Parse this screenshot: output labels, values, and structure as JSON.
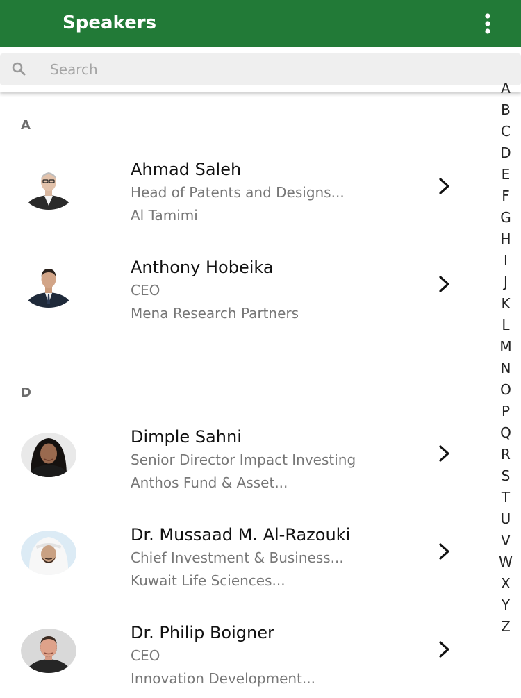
{
  "appbar": {
    "title": "Speakers",
    "menu_icon": "more-vertical-icon",
    "color": "#227a37"
  },
  "search": {
    "placeholder": "Search",
    "value": "",
    "icon": "search-icon"
  },
  "sections": [
    {
      "letter": "A",
      "speakers": [
        {
          "name": "Ahmad Saleh",
          "title": "Head of Patents and Designs...",
          "org": "Al Tamimi"
        },
        {
          "name": "Anthony Hobeika",
          "title": "CEO",
          "org": "Mena Research Partners"
        }
      ]
    },
    {
      "letter": "D",
      "speakers": [
        {
          "name": "Dimple Sahni",
          "title": "Senior Director Impact Investing",
          "org": "Anthos Fund & Asset..."
        },
        {
          "name": "Dr. Mussaad M. Al-Razouki",
          "title": "Chief Investment & Business...",
          "org": "Kuwait Life Sciences..."
        },
        {
          "name": "Dr. Philip Boigner",
          "title": "CEO",
          "org": "Innovation Development..."
        }
      ]
    }
  ],
  "alphabet_index": [
    "A",
    "B",
    "C",
    "D",
    "E",
    "F",
    "G",
    "H",
    "I",
    "J",
    "K",
    "L",
    "M",
    "N",
    "O",
    "P",
    "Q",
    "R",
    "S",
    "T",
    "U",
    "V",
    "W",
    "X",
    "Y",
    "Z"
  ],
  "row_chevron_icon": "chevron-right-icon"
}
